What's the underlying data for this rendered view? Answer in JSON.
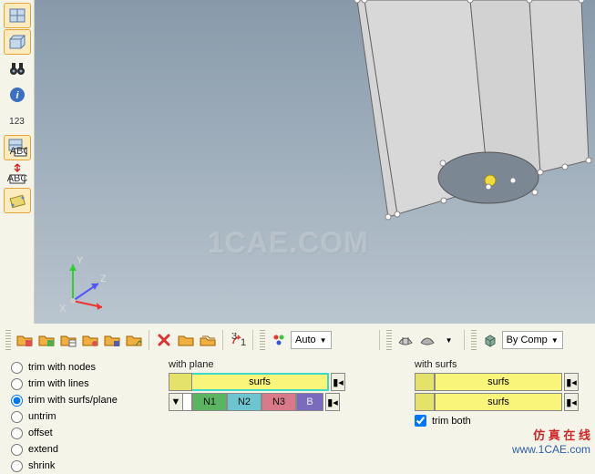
{
  "leftTools": {
    "t1": "grid-icon",
    "t2": "grid3d-icon",
    "t3": "binoculars-icon",
    "t4": "info-icon",
    "t5_label": "123",
    "t6": "abc-grid-icon",
    "t7": "abc-arrow-icon",
    "t8": "measure-icon"
  },
  "viewport": {
    "watermark": "1CAE.COM",
    "axes": {
      "x": "X",
      "y": "Y",
      "z": "Z"
    }
  },
  "toolbar2": {
    "auto_label": "Auto",
    "bycomp_label": "By Comp"
  },
  "panel": {
    "radios": {
      "r1": "trim with nodes",
      "r2": "trim with lines",
      "r3": "trim with surfs/plane",
      "r4": "untrim",
      "r5": "offset",
      "r6": "extend",
      "r7": "shrink"
    },
    "withPlane": {
      "title": "with plane",
      "surfs": "surfs",
      "n1": "N1",
      "n2": "N2",
      "n3": "N3",
      "b": "B"
    },
    "withSurfs": {
      "title": "with surfs",
      "surfs": "surfs",
      "trimBoth": "trim both"
    }
  },
  "credit": {
    "line1": "仿 真 在 线",
    "line2": "www.1CAE.com"
  }
}
